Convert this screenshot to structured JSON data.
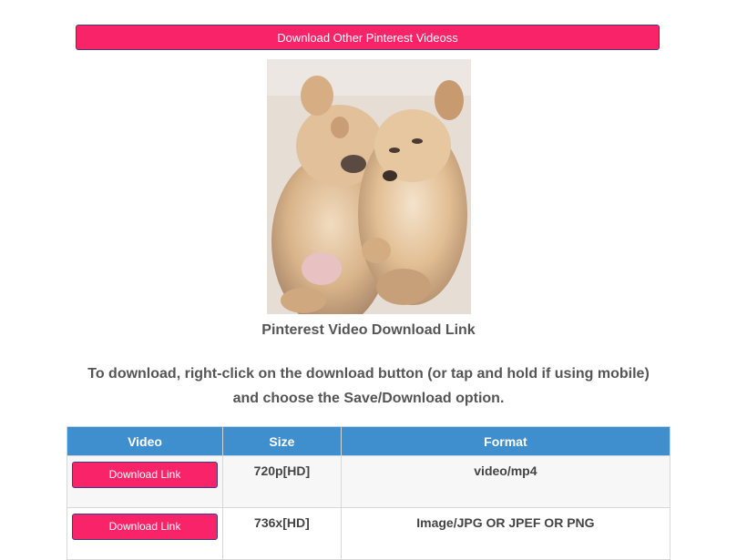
{
  "top_button": {
    "label": "Download Other Pinterest Videoss"
  },
  "video_thumbnail": {
    "alt": "Two sleeping fluffy puppies"
  },
  "caption": "Pinterest Video Download Link",
  "instructions": "To download, right-click on the download button (or tap and hold if using mobile) and choose the Save/Download option.",
  "table": {
    "headers": {
      "video": "Video",
      "size": "Size",
      "format": "Format"
    },
    "rows": [
      {
        "button": "Download Link",
        "size": "720p[HD]",
        "format": "video/mp4"
      },
      {
        "button": "Download Link",
        "size": "736x[HD]",
        "format": "Image/JPG OR JPEF OR PNG"
      }
    ]
  },
  "colors": {
    "accent": "#f9236a",
    "header": "#3f8fcf",
    "text": "#555555"
  }
}
